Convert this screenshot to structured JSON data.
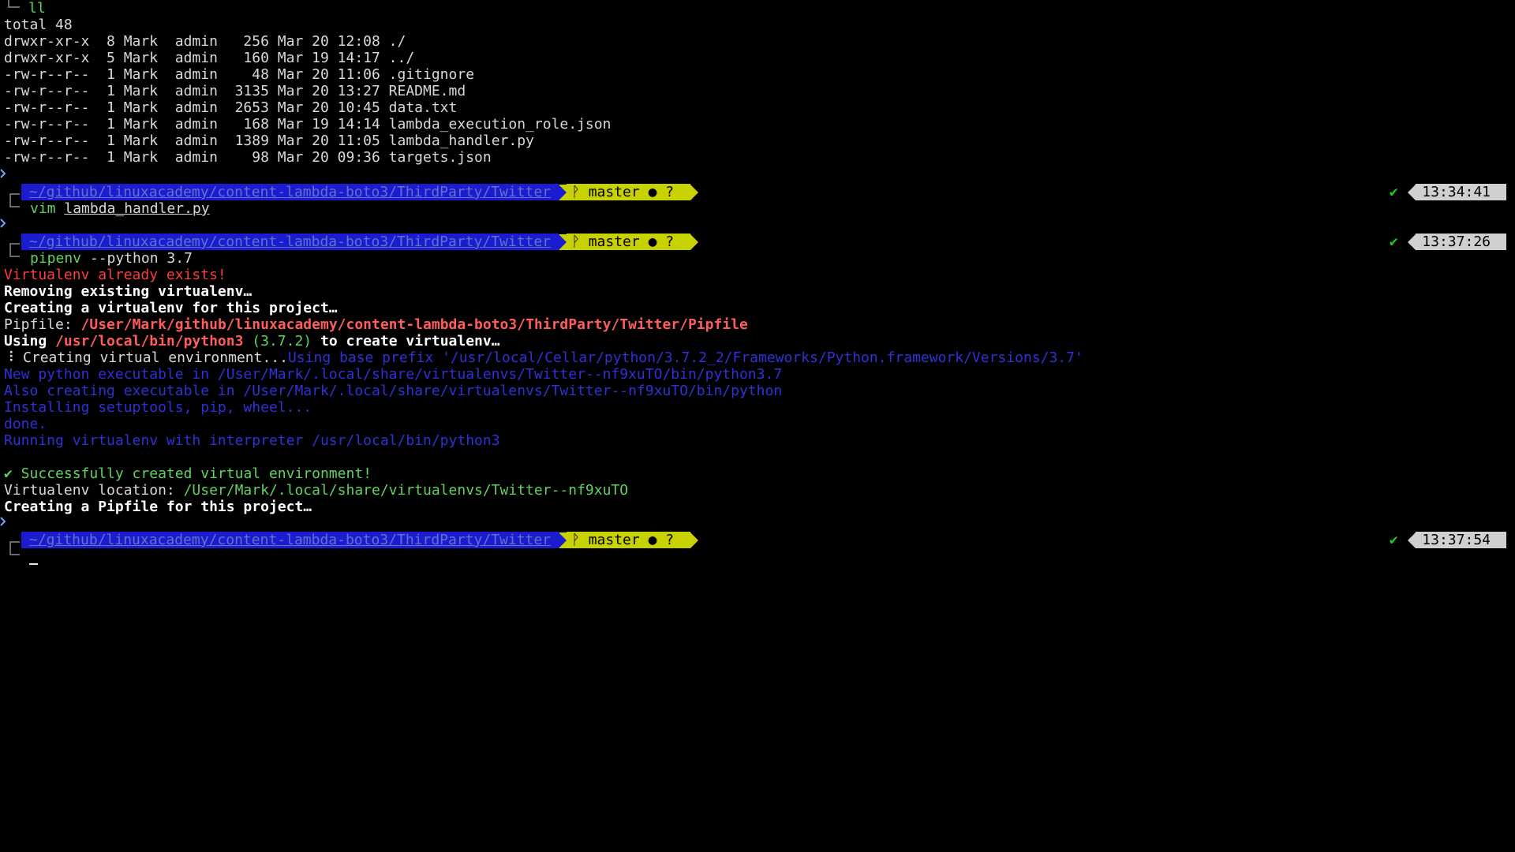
{
  "theme": {
    "background": "#000000",
    "path_segment_bg": "#1b1bd0",
    "git_segment_bg": "#c8d200",
    "time_segment_bg": "#d0d0d0",
    "success_green": "#5fd35f",
    "error_red": "#ff3b3b",
    "info_blue": "#3030d8"
  },
  "block1": {
    "command": "ll",
    "total": "total 48",
    "listing": [
      "drwxr-xr-x  8 Mark  admin   256 Mar 20 12:08 ./",
      "drwxr-xr-x  5 Mark  admin   160 Mar 19 14:17 ../",
      "-rw-r--r--  1 Mark  admin    48 Mar 20 11:06 .gitignore",
      "-rw-r--r--  1 Mark  admin  3135 Mar 20 13:27 README.md",
      "-rw-r--r--  1 Mark  admin  2653 Mar 20 10:45 data.txt",
      "-rw-r--r--  1 Mark  admin   168 Mar 19 14:14 lambda_execution_role.json",
      "-rw-r--r--  1 Mark  admin  1389 Mar 20 11:05 lambda_handler.py",
      "-rw-r--r--  1 Mark  admin    98 Mar 20 09:36 targets.json"
    ]
  },
  "prompts": [
    {
      "path": "~/github/linuxacademy/content-lambda-boto3/ThirdParty/Twitter",
      "branch_icon": "git-branch-icon",
      "git": " master ● ? ",
      "status_icon": "check-icon",
      "status": "✔",
      "time": "13:34:41"
    },
    {
      "path": "~/github/linuxacademy/content-lambda-boto3/ThirdParty/Twitter",
      "branch_icon": "git-branch-icon",
      "git": " master ● ? ",
      "status_icon": "check-icon",
      "status": "✔",
      "time": "13:37:26"
    },
    {
      "path": "~/github/linuxacademy/content-lambda-boto3/ThirdParty/Twitter",
      "branch_icon": "git-branch-icon",
      "git": " master ● ? ",
      "status_icon": "check-icon",
      "status": "✔",
      "time": "13:37:54"
    }
  ],
  "block2": {
    "cmd": "vim",
    "arg": "lambda_handler.py"
  },
  "block3": {
    "cmd": "pipenv",
    "args": " --python 3.7",
    "exists": "Virtualenv already exists!",
    "removing": "Removing existing virtualenv…",
    "creating": "Creating a virtualenv for this project…",
    "pipfile_label": "Pipfile: ",
    "pipfile_path": "/User/Mark/github/linuxacademy/content-lambda-boto3/ThirdParty/Twitter/Pipfile",
    "using_label": "Using ",
    "using_python": "/usr/local/bin/python3",
    "using_version": " (3.7.2)",
    "using_suffix": " to create virtualenv…",
    "spinner": "⠸",
    "creating_env": " Creating virtual environment...",
    "base_prefix": "Using base prefix '/usr/local/Cellar/python/3.7.2_2/Frameworks/Python.framework/Versions/3.7'",
    "new_exec": "New python executable in /User/Mark/.local/share/virtualenvs/Twitter--nf9xuTO/bin/python3.7",
    "also_exec": "Also creating executable in /User/Mark/.local/share/virtualenvs/Twitter--nf9xuTO/bin/python",
    "installing": "Installing setuptools, pip, wheel...",
    "done": "done.",
    "running": "Running virtualenv with interpreter /usr/local/bin/python3",
    "success_icon": "check-icon",
    "success_mark": "✔",
    "success": " Successfully created virtual environment!",
    "location_label": "Virtualenv location: ",
    "location_path": "/User/Mark/.local/share/virtualenvs/Twitter--nf9xuTO",
    "creating_pipfile": "Creating a Pipfile for this project…"
  }
}
